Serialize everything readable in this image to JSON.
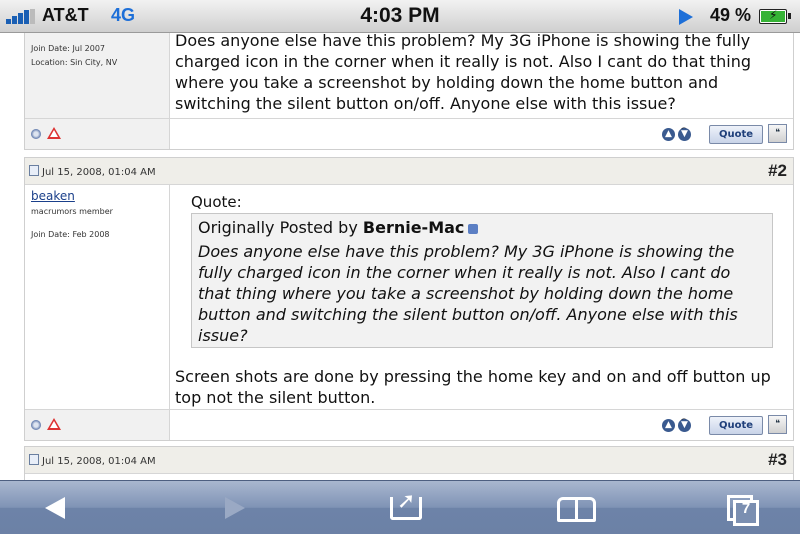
{
  "status_bar": {
    "carrier": "AT&T",
    "network": "4G",
    "time": "4:03 PM",
    "battery_percent": "49 %",
    "battery_level": 0.49
  },
  "posts": [
    {
      "join_date": "Join Date: Jul 2007",
      "location": "Location: Sin City, NV",
      "message": "Does anyone else have this problem? My 3G iPhone is showing the fully charged icon in the corner when it really is not. Also I cant do that thing where you take a screenshot by holding down the home button and switching the silent button on/off. Anyone else with this issue?",
      "reputation": "0",
      "quote_label": "Quote"
    },
    {
      "date": "Jul 15, 2008, 01:04 AM",
      "number": "#2",
      "username": "beaken",
      "user_title": "macrumors member",
      "join_date": "Join Date: Feb 2008",
      "quote_label_text": "Quote:",
      "quote_posted_by": "Originally Posted by",
      "quote_author": "Bernie-Mac",
      "quote_text": "Does anyone else have this problem? My 3G iPhone is showing the fully charged icon in the corner when it really is not. Also I cant do that thing where you take a screenshot by holding down the home button and switching the silent button on/off. Anyone else with this issue?",
      "message": "Screen shots are done by pressing the home key and on and off button up top not the silent button.",
      "reputation": "0",
      "quote_label": "Quote"
    },
    {
      "date": "Jul 15, 2008, 01:04 AM",
      "number": "#3"
    }
  ],
  "toolbar": {
    "tab_count": "7"
  },
  "icons": {
    "back": "back-arrow-icon",
    "forward": "forward-arrow-icon",
    "share": "share-icon",
    "bookmarks": "bookmarks-book-icon",
    "pages": "pages-icon"
  }
}
